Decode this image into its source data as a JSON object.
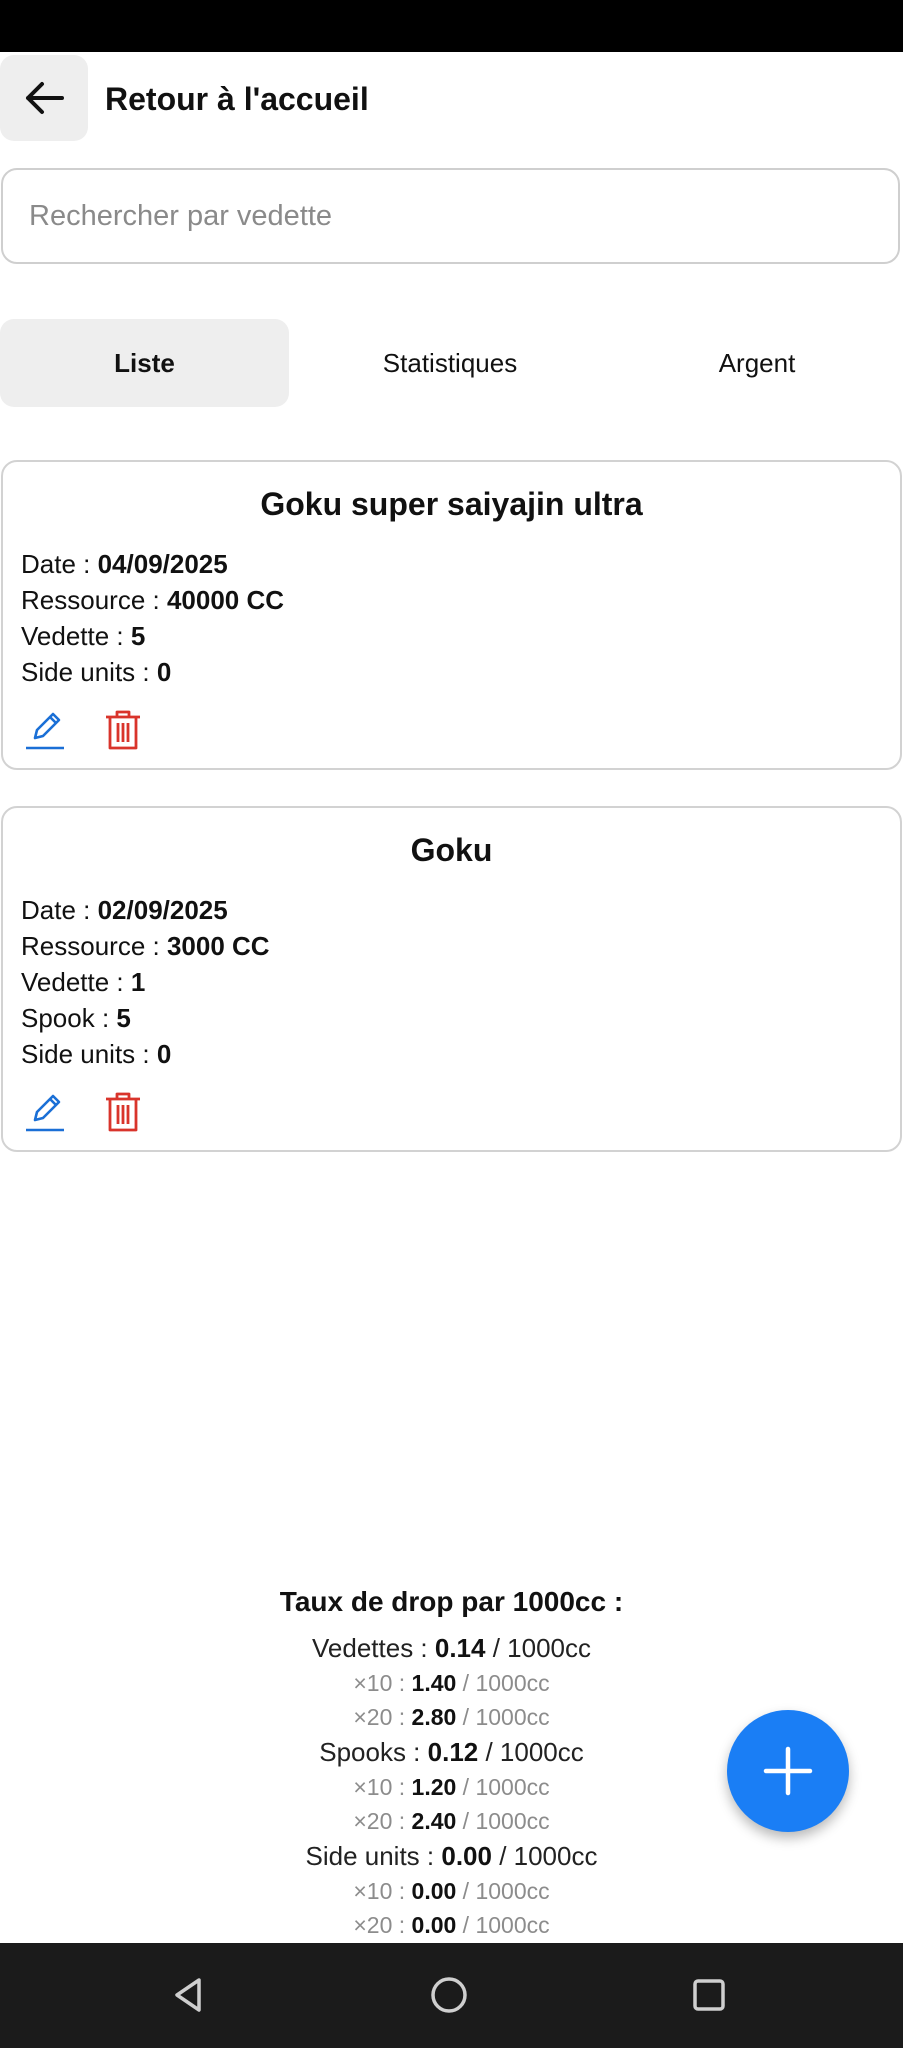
{
  "header": {
    "back_icon": "arrow-left-icon",
    "title": "Retour à l'accueil"
  },
  "search": {
    "placeholder": "Rechercher par vedette",
    "value": ""
  },
  "tabs": [
    {
      "label": "Liste",
      "active": true
    },
    {
      "label": "Statistiques",
      "active": false
    },
    {
      "label": "Argent",
      "active": false
    }
  ],
  "cards": [
    {
      "title": "Goku super saiyajin ultra",
      "date_label": "Date : ",
      "date": "04/09/2025",
      "resource_label": "Ressource : ",
      "resource": "40000 CC",
      "vedette_label": "Vedette : ",
      "vedette": "5",
      "side_label": "Side units : ",
      "side": "0"
    },
    {
      "title": "Goku",
      "date_label": "Date : ",
      "date": "02/09/2025",
      "resource_label": "Ressource : ",
      "resource": "3000 CC",
      "vedette_label": "Vedette : ",
      "vedette": "1",
      "spook_label": "Spook : ",
      "spook": "5",
      "side_label": "Side units : ",
      "side": "0"
    }
  ],
  "stats": {
    "title": "Taux de drop par 1000cc :",
    "unit": " / 1000cc",
    "vedettes": {
      "label": "Vedettes : ",
      "value": "0.14",
      "x10_label": "×10 : ",
      "x10": "1.40",
      "x20_label": "×20 : ",
      "x20": "2.80"
    },
    "spooks": {
      "label": "Spooks : ",
      "value": "0.12",
      "x10_label": "×10 : ",
      "x10": "1.20",
      "x20_label": "×20 : ",
      "x20": "2.40"
    },
    "side_units": {
      "label": "Side units : ",
      "value": "0.00",
      "x10_label": "×10 : ",
      "x10": "0.00",
      "x20_label": "×20 : ",
      "x20": "0.00"
    }
  },
  "colors": {
    "accent": "#1a7ef5",
    "edit": "#1a6fd6",
    "delete": "#d9342b"
  },
  "fab": {
    "icon": "plus-icon"
  },
  "nav": [
    "back-triangle-icon",
    "home-circle-icon",
    "recents-square-icon"
  ]
}
